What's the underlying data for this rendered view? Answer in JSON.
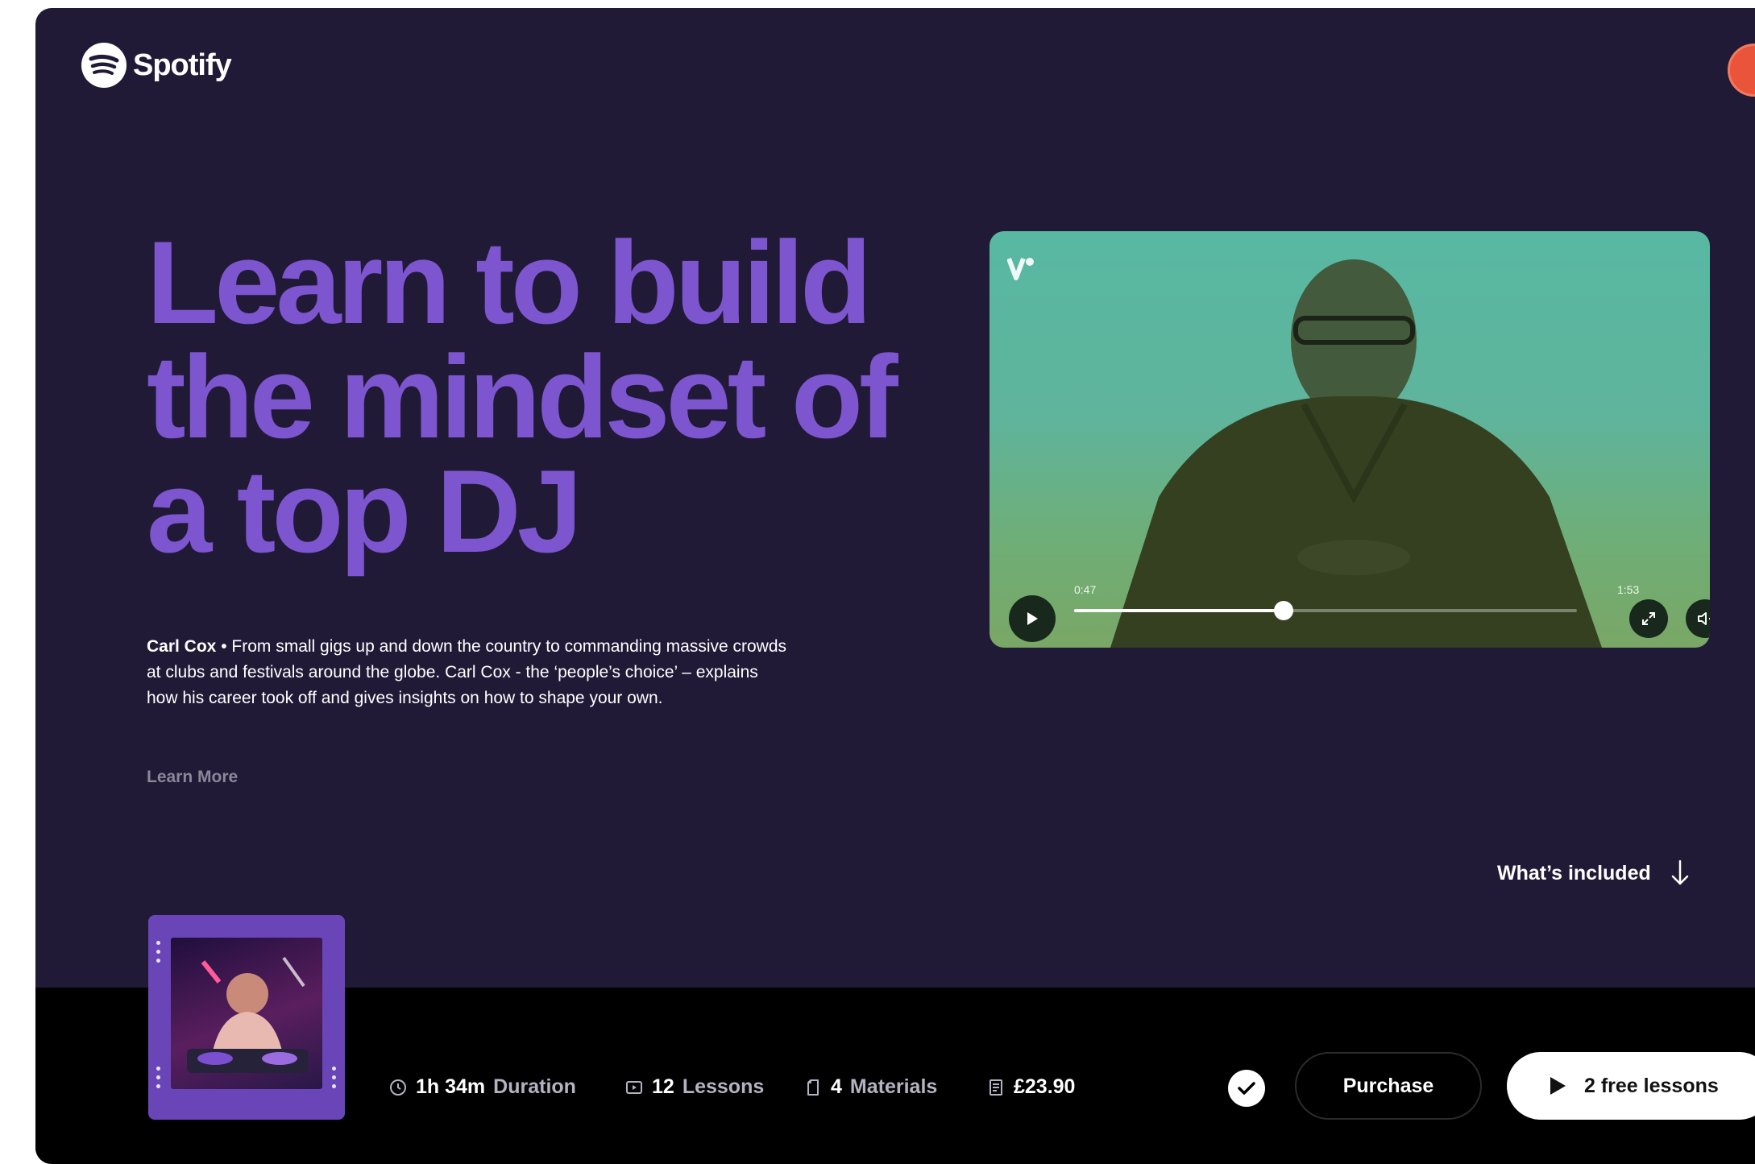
{
  "header": {
    "brand": "Spotify"
  },
  "hero": {
    "title": "Learn to build the mindset of a top DJ",
    "author": "Carl Cox",
    "separator": " • ",
    "description": "From small gigs up and down the country to commanding massive crowds at clubs and festivals around the globe. Carl Cox - the ‘people’s choice’ – explains how his career took off and gives insights on how to shape your own.",
    "learn_more": "Learn More"
  },
  "video": {
    "current_time": "0:47",
    "total_time": "1:53",
    "progress": 0.416
  },
  "whats_included": {
    "label": "What’s included"
  },
  "stats": {
    "duration": {
      "value": "1h 34m",
      "label": "Duration"
    },
    "lessons": {
      "value": "12",
      "label": "Lessons"
    },
    "materials": {
      "value": "4",
      "label": "Materials"
    },
    "price": {
      "value": "£23.90"
    }
  },
  "actions": {
    "purchase": "Purchase",
    "free_lessons": "2 free lessons"
  },
  "colors": {
    "page_bg": "#211a37",
    "headline": "#7c55cf",
    "bar_bg": "#000000",
    "avatar": "#e9543b"
  },
  "icons": {
    "logo": "spotify-logo-icon",
    "duration": "clock-icon",
    "lessons": "video-lesson-icon",
    "materials": "document-icon",
    "price": "receipt-icon",
    "play": "play-icon",
    "fullscreen": "expand-icon",
    "volume": "volume-icon",
    "arrow": "arrow-down-icon",
    "check": "check-icon"
  }
}
